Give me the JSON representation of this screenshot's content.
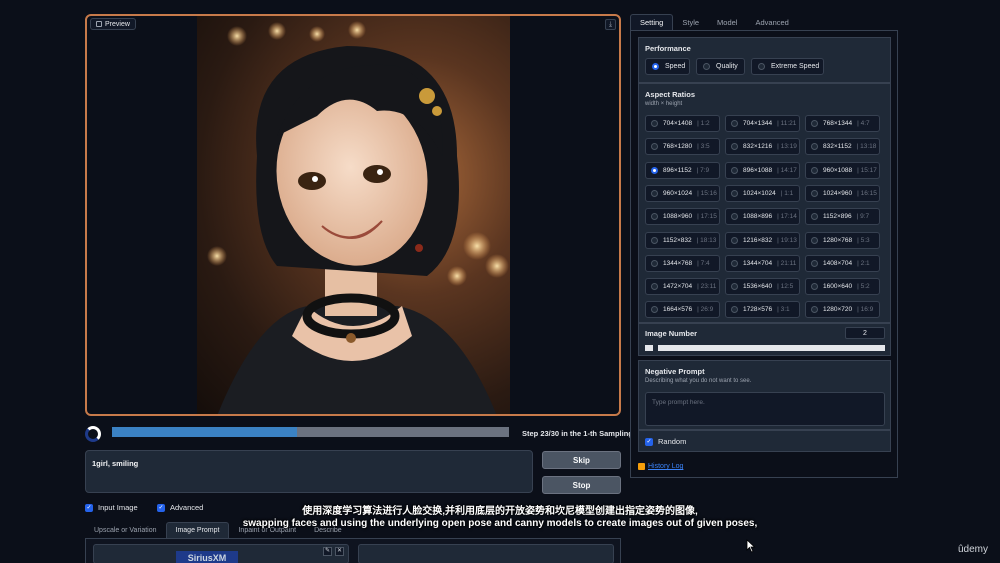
{
  "preview": {
    "label": "Preview",
    "corner_icon": "download-icon"
  },
  "progress": {
    "fraction": 0.4667,
    "status_text": "Step 23/30 in the 1-th Sampling"
  },
  "prompt": {
    "value": "1girl, smiling"
  },
  "buttons": {
    "skip": "Skip",
    "stop": "Stop"
  },
  "checks": {
    "input_image": "Input Image",
    "advanced": "Advanced"
  },
  "bottom_tabs": [
    "Upscale or Variation",
    "Image Prompt",
    "Inpaint or Outpaint",
    "Describe"
  ],
  "bottom_tab_active": 1,
  "image_prompt_logo": "SiriusXM",
  "settings_tabs": [
    "Setting",
    "Style",
    "Model",
    "Advanced"
  ],
  "settings_tab_active": 0,
  "performance": {
    "title": "Performance",
    "options": [
      "Speed",
      "Quality",
      "Extreme Speed"
    ],
    "selected": 0
  },
  "aspect_ratios": {
    "title": "Aspect Ratios",
    "subtitle": "width × height",
    "selected": 6,
    "options": [
      {
        "size": "704×1408",
        "ratio": "| 1:2"
      },
      {
        "size": "704×1344",
        "ratio": "| 11:21"
      },
      {
        "size": "768×1344",
        "ratio": "| 4:7"
      },
      {
        "size": "768×1280",
        "ratio": "| 3:5"
      },
      {
        "size": "832×1216",
        "ratio": "| 13:19"
      },
      {
        "size": "832×1152",
        "ratio": "| 13:18"
      },
      {
        "size": "896×1152",
        "ratio": "| 7:9"
      },
      {
        "size": "896×1088",
        "ratio": "| 14:17"
      },
      {
        "size": "960×1088",
        "ratio": "| 15:17"
      },
      {
        "size": "960×1024",
        "ratio": "| 15:16"
      },
      {
        "size": "1024×1024",
        "ratio": "| 1:1"
      },
      {
        "size": "1024×960",
        "ratio": "| 16:15"
      },
      {
        "size": "1088×960",
        "ratio": "| 17:15"
      },
      {
        "size": "1088×896",
        "ratio": "| 17:14"
      },
      {
        "size": "1152×896",
        "ratio": "| 9:7"
      },
      {
        "size": "1152×832",
        "ratio": "| 18:13"
      },
      {
        "size": "1216×832",
        "ratio": "| 19:13"
      },
      {
        "size": "1280×768",
        "ratio": "| 5:3"
      },
      {
        "size": "1344×768",
        "ratio": "| 7:4"
      },
      {
        "size": "1344×704",
        "ratio": "| 21:11"
      },
      {
        "size": "1408×704",
        "ratio": "| 2:1"
      },
      {
        "size": "1472×704",
        "ratio": "| 23:11"
      },
      {
        "size": "1536×640",
        "ratio": "| 12:5"
      },
      {
        "size": "1600×640",
        "ratio": "| 5:2"
      },
      {
        "size": "1664×576",
        "ratio": "| 26:9"
      },
      {
        "size": "1728×576",
        "ratio": "| 3:1"
      },
      {
        "size": "1280×720",
        "ratio": "| 16:9"
      }
    ]
  },
  "image_number": {
    "title": "Image Number",
    "value": "2"
  },
  "negative_prompt": {
    "title": "Negative Prompt",
    "subtitle": "Describing what you do not want to see.",
    "placeholder": "Type prompt here."
  },
  "random": {
    "label": "Random"
  },
  "history_log": "History Log",
  "subtitles": {
    "chinese": "使用深度学习算法进行人脸交换,并利用底层的开放姿势和坎尼模型创建出指定姿势的图像,",
    "english": "swapping faces and using the underlying open pose and canny models to create images out of given poses,"
  },
  "watermark": "ûdemy",
  "colors": {
    "accent": "#2563eb",
    "progress": "#3b82c4",
    "preview_border": "#c77a4a",
    "background": "#0b0f19"
  }
}
